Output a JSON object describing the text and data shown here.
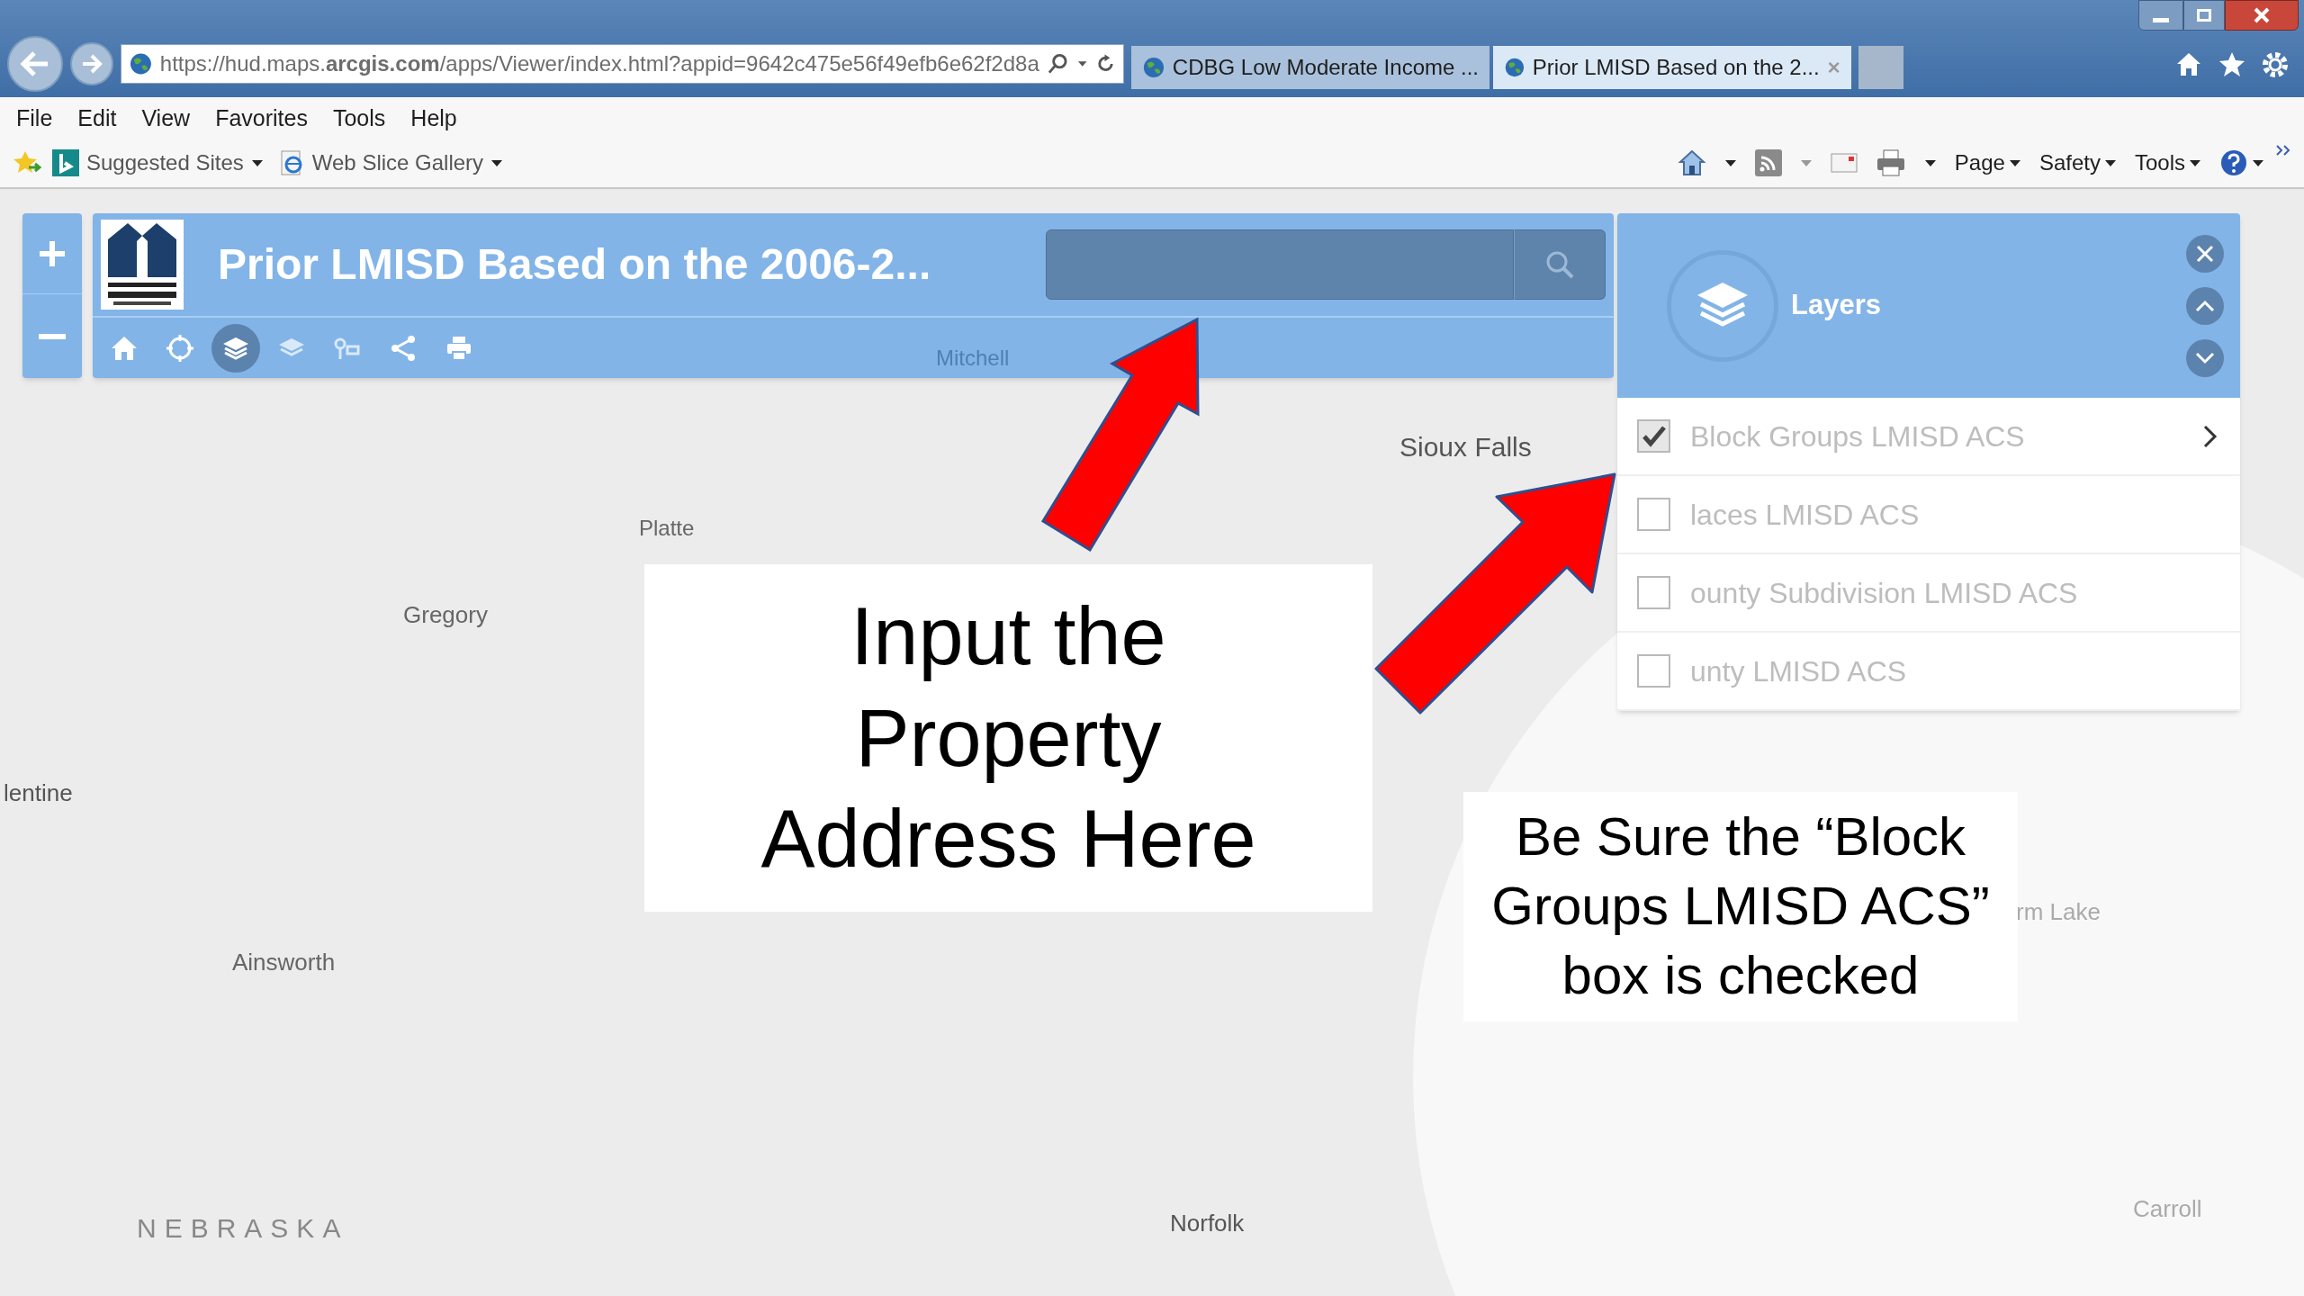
{
  "browser": {
    "address": "https://hud.maps.**arcgis.com**/apps/Viewer/index.html?appid=9642c475e56f49efb6e62f2d8a",
    "tabs": [
      {
        "title": "CDBG Low Moderate Income ...",
        "selected": false
      },
      {
        "title": "Prior LMISD Based on the 2...",
        "selected": true
      }
    ],
    "menu": [
      "File",
      "Edit",
      "View",
      "Favorites",
      "Tools",
      "Help"
    ],
    "favorites": [
      {
        "label": "Suggested Sites",
        "kind": "bing"
      },
      {
        "label": "Web Slice Gallery",
        "kind": "slice"
      }
    ],
    "commands": [
      "Page",
      "Safety",
      "Tools"
    ]
  },
  "app": {
    "title": "Prior LMISD Based on the 2006-2...",
    "tools": [
      {
        "kind": "home",
        "selected": false
      },
      {
        "kind": "locate",
        "selected": false
      },
      {
        "kind": "layers",
        "selected": true
      },
      {
        "kind": "basemap",
        "selected": false
      },
      {
        "kind": "legend",
        "selected": false
      },
      {
        "kind": "share",
        "selected": false
      },
      {
        "kind": "print",
        "selected": false
      }
    ],
    "layers_panel": {
      "title": "Layers",
      "items": [
        {
          "label": "Block Groups LMISD ACS",
          "checked": true,
          "expandable": true
        },
        {
          "label": "laces LMISD ACS",
          "checked": false,
          "expandable": false
        },
        {
          "label": "ounty Subdivision LMISD ACS",
          "checked": false,
          "expandable": false
        },
        {
          "label": "unty LMISD ACS",
          "checked": false,
          "expandable": false
        }
      ]
    },
    "map_labels": [
      "Mitchell",
      "Sioux Falls",
      "Platte",
      "Gregory",
      "lentine",
      "Ainsworth",
      "NEBRASKA",
      "Norfolk",
      "rm Lake",
      "Carroll"
    ]
  },
  "callouts": [
    "Input the Property Address Here",
    "Be Sure the “Block Groups LMISD ACS” box is checked"
  ]
}
